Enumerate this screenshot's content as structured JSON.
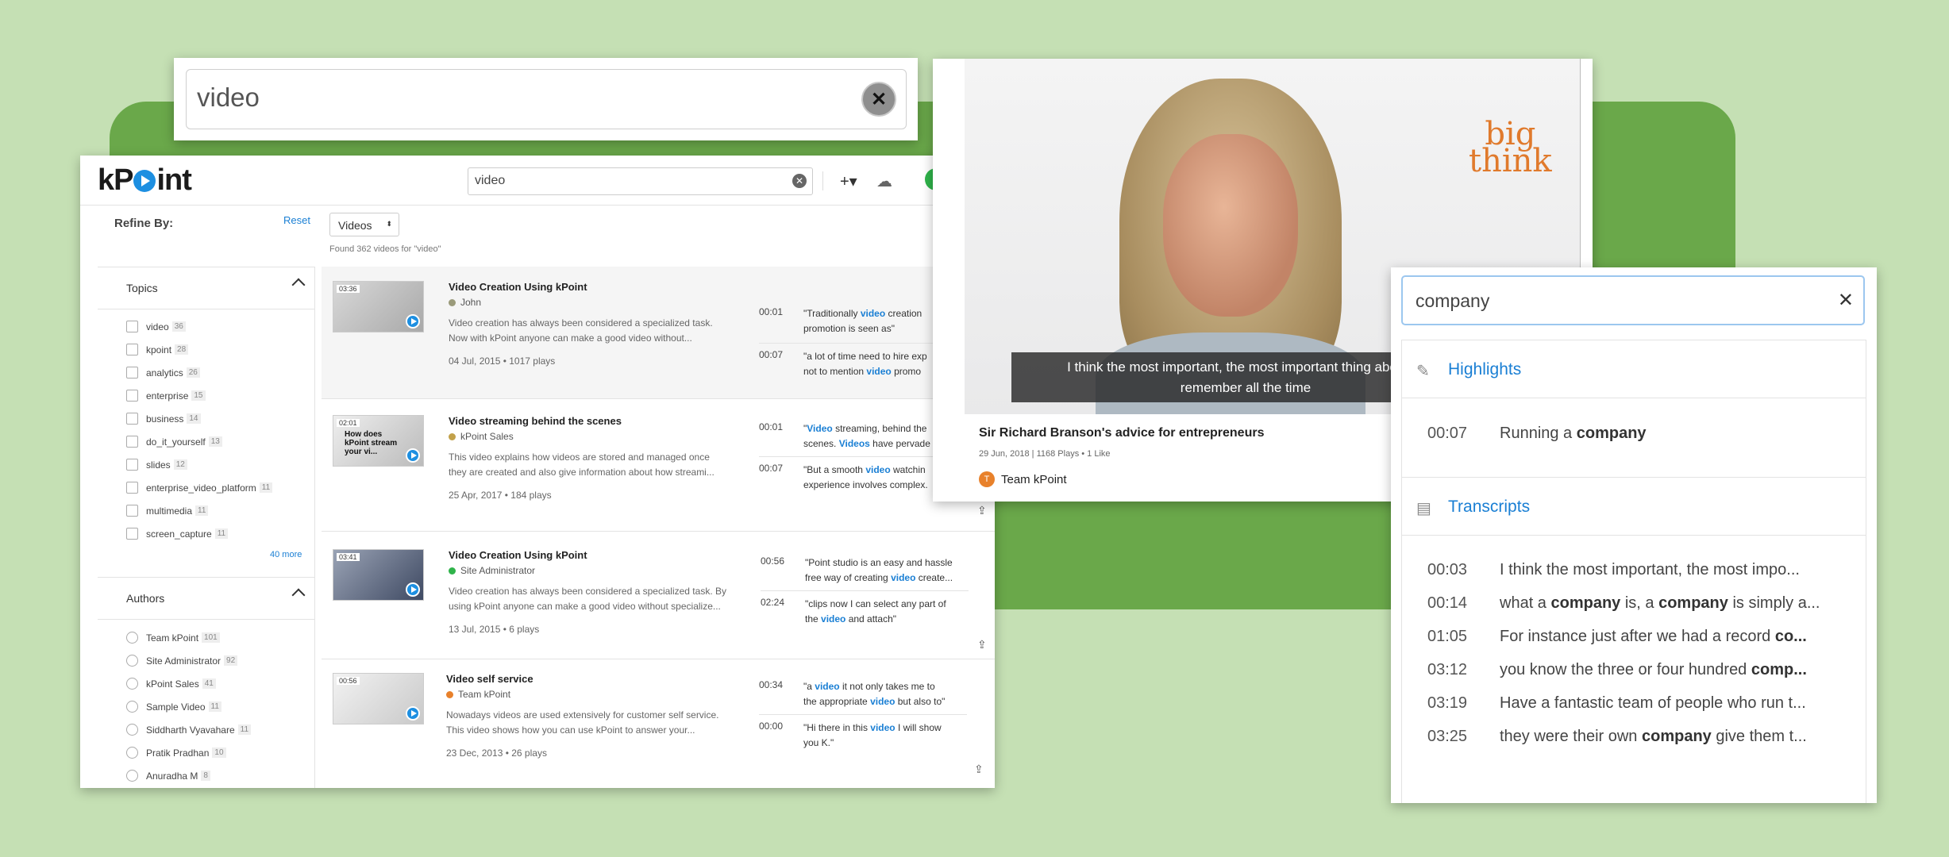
{
  "top_search": {
    "query": "video"
  },
  "app": {
    "logo": {
      "left": "kP",
      "right": "int"
    },
    "search": {
      "query": "video"
    },
    "refine_label": "Refine By:",
    "reset_label": "Reset",
    "type_select": "Videos",
    "found_text": "Found 362 videos for \"video\"",
    "topics": {
      "heading": "Topics",
      "items": [
        {
          "label": "video",
          "count": "36"
        },
        {
          "label": "kpoint",
          "count": "28"
        },
        {
          "label": "analytics",
          "count": "26"
        },
        {
          "label": "enterprise",
          "count": "15"
        },
        {
          "label": "business",
          "count": "14"
        },
        {
          "label": "do_it_yourself",
          "count": "13"
        },
        {
          "label": "slides",
          "count": "12"
        },
        {
          "label": "enterprise_video_platform",
          "count": "11"
        },
        {
          "label": "multimedia",
          "count": "11"
        },
        {
          "label": "screen_capture",
          "count": "11"
        }
      ],
      "more": "40 more"
    },
    "authors": {
      "heading": "Authors",
      "items": [
        {
          "label": "Team kPoint",
          "count": "101"
        },
        {
          "label": "Site Administrator",
          "count": "92"
        },
        {
          "label": "kPoint Sales",
          "count": "41"
        },
        {
          "label": "Sample Video",
          "count": "11"
        },
        {
          "label": "Siddharth Vyavahare",
          "count": "11"
        },
        {
          "label": "Pratik Pradhan",
          "count": "10"
        },
        {
          "label": "Anuradha M",
          "count": "8"
        }
      ]
    },
    "results": [
      {
        "title": "Video Creation Using kPoint",
        "duration": "03:36",
        "author": "John",
        "author_color": "#9a9a7a",
        "desc1": "Video creation has always been considered a specialized task.",
        "desc2": "Now with kPoint anyone can make a good video without...",
        "meta": "04 Jul, 2015 • 1017 plays",
        "snippets": [
          {
            "ts": "00:01",
            "pre": "\"Traditionally ",
            "hl": "video",
            "post": " creation",
            "line2": "promotion is seen as\""
          },
          {
            "ts": "00:07",
            "pre": "\"a lot of time need to hire exp",
            "hl": "",
            "post": "",
            "line2_pre": "not to mention ",
            "line2_hl": "video",
            "line2_post": " promo"
          }
        ]
      },
      {
        "title": "Video streaming behind the scenes",
        "duration": "02:01",
        "author": "kPoint Sales",
        "author_color": "#c2a14a",
        "thumb_text": "How does kPoint stream your vi...",
        "desc1": "This video explains how videos are stored and managed once",
        "desc2": "they are created and also give information about how streami...",
        "meta": "25 Apr, 2017 • 184 plays",
        "snippets": [
          {
            "ts": "00:01",
            "pre": "\"",
            "hl": "Video",
            "post": " streaming, behind the",
            "line2_pre": "scenes. ",
            "line2_hl": "Videos",
            "line2_post": " have pervade"
          },
          {
            "ts": "00:07",
            "pre": "\"But a smooth ",
            "hl": "video",
            "post": " watchin",
            "line2": "experience involves complex."
          }
        ]
      },
      {
        "title": "Video Creation Using kPoint",
        "duration": "03:41",
        "author": "Site Administrator",
        "author_color": "#2fb34a",
        "desc1": "Video creation has always been considered a specialized task. By",
        "desc2": "using kPoint anyone can make a good video without specialize...",
        "meta": "13 Jul, 2015 • 6 plays",
        "snippets": [
          {
            "ts": "00:56",
            "pre": "\"Point studio is an easy and hassle",
            "hl": "",
            "post": "",
            "line2_pre": "free way of creating ",
            "line2_hl": "video",
            "line2_post": " create..."
          },
          {
            "ts": "02:24",
            "pre": "\"clips now I can select any part of",
            "hl": "",
            "post": "",
            "line2_pre": "the ",
            "line2_hl": "video",
            "line2_post": " and attach\""
          }
        ]
      },
      {
        "title": "Video self service",
        "duration": "00:56",
        "author": "Team kPoint",
        "author_color": "#e8812b",
        "desc1": "Nowadays videos are used extensively for customer self service.",
        "desc2": "This video shows how you can use kPoint to answer your...",
        "meta": "23 Dec, 2013 • 26 plays",
        "snippets": [
          {
            "ts": "00:34",
            "pre": "\"a ",
            "hl": "video",
            "post": " it not only takes me to",
            "line2_pre": "the appropriate ",
            "line2_hl": "video",
            "line2_post": " but also to\""
          },
          {
            "ts": "00:00",
            "pre": "\"Hi there in this ",
            "hl": "video",
            "post": " I will show",
            "line2": "you K.\""
          }
        ]
      }
    ]
  },
  "video_card": {
    "brand_top": "big",
    "brand_bottom": "think",
    "caption_line1": "I think the most important, the most important thing about ru",
    "caption_line2": "remember all the time",
    "title": "Sir Richard Branson's advice for entrepreneurs",
    "meta": "29 Jun, 2018 | 1168 Plays • 1 Like",
    "author_initial": "T",
    "author": "Team kPoint"
  },
  "company_panel": {
    "query": "company",
    "highlights_heading": "Highlights",
    "highlights": [
      {
        "ts": "00:07",
        "pre": "Running a ",
        "hl": "company",
        "post": ""
      }
    ],
    "transcripts_heading": "Transcripts",
    "transcripts": [
      {
        "ts": "00:03",
        "text": "I think the most important, the most impo..."
      },
      {
        "ts": "00:14",
        "pre": "what a ",
        "hl": "company",
        "mid": " is, a ",
        "hl2": "company",
        "post": " is simply a..."
      },
      {
        "ts": "01:05",
        "pre": "For instance just after we had a record ",
        "hl": "co..."
      },
      {
        "ts": "03:12",
        "pre": "you know the three or four hundred ",
        "hl": "comp..."
      },
      {
        "ts": "03:19",
        "text": "Have a fantastic team of people who run t..."
      },
      {
        "ts": "03:25",
        "pre": "they were their own ",
        "hl": "company",
        "post": " give them t..."
      }
    ]
  }
}
